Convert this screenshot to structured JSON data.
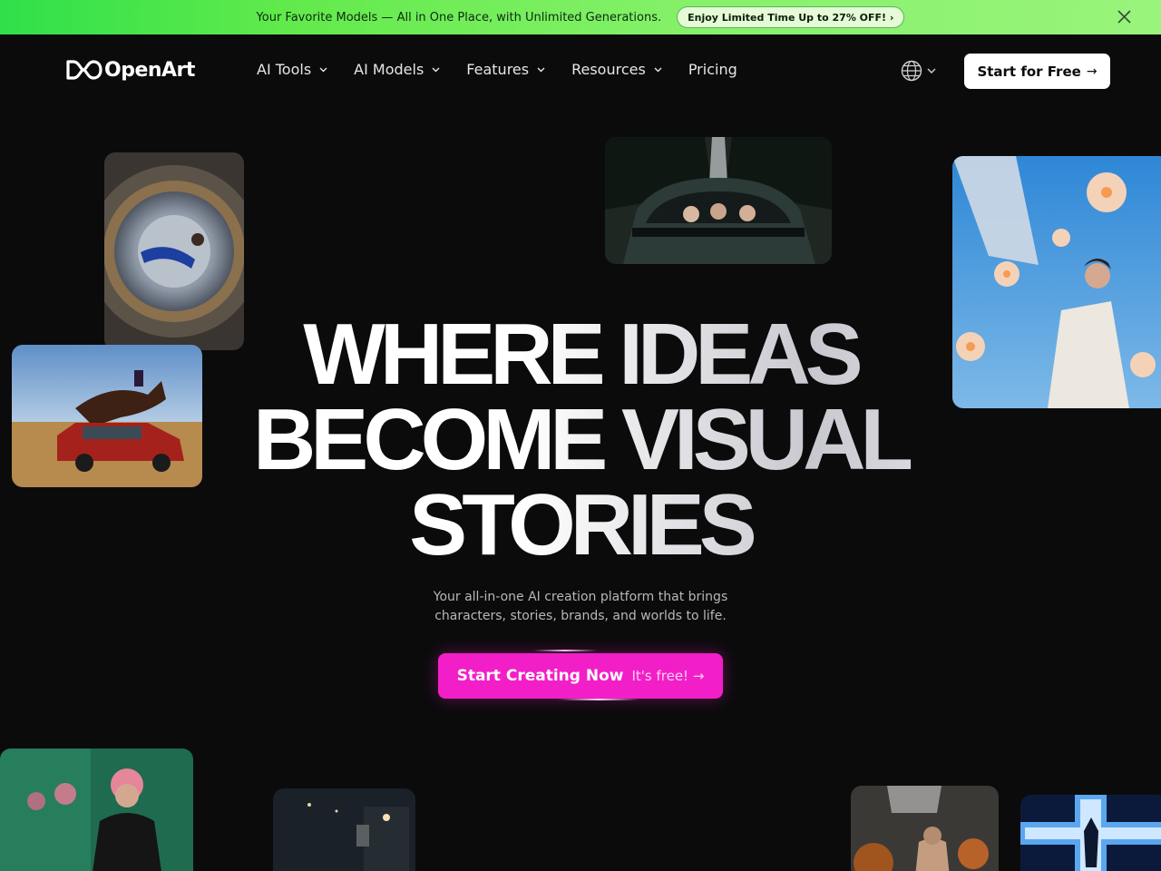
{
  "promo": {
    "text": "Your Favorite Models — All in One Place, with Unlimited Generations.",
    "badge": "Enjoy Limited Time Up to 27% OFF! ›"
  },
  "nav": {
    "logo": "OpenArt",
    "items": [
      {
        "label": "AI Tools",
        "has_dropdown": true
      },
      {
        "label": "AI Models",
        "has_dropdown": true
      },
      {
        "label": "Features",
        "has_dropdown": true
      },
      {
        "label": "Resources",
        "has_dropdown": true
      },
      {
        "label": "Pricing",
        "has_dropdown": false
      }
    ],
    "start_button": "Start for Free",
    "start_arrow": "→"
  },
  "hero": {
    "title_line1": "WHERE IDEAS",
    "title_line2": "BECOME VISUAL",
    "title_line3": "STORIES",
    "subtitle_line1": "Your all-in-one AI creation platform that brings",
    "subtitle_line2": "characters, stories, brands, and worlds to life.",
    "cta_main": "Start Creating Now",
    "cta_secondary": "It's free! →"
  },
  "colors": {
    "promo_green": "#62ea4c",
    "background": "#0b0b0c",
    "cta_pink": "#f21fc8"
  },
  "icons": [
    "logo-infinity-icon",
    "chevron-down-icon",
    "globe-icon",
    "close-icon",
    "arrow-right-icon"
  ]
}
